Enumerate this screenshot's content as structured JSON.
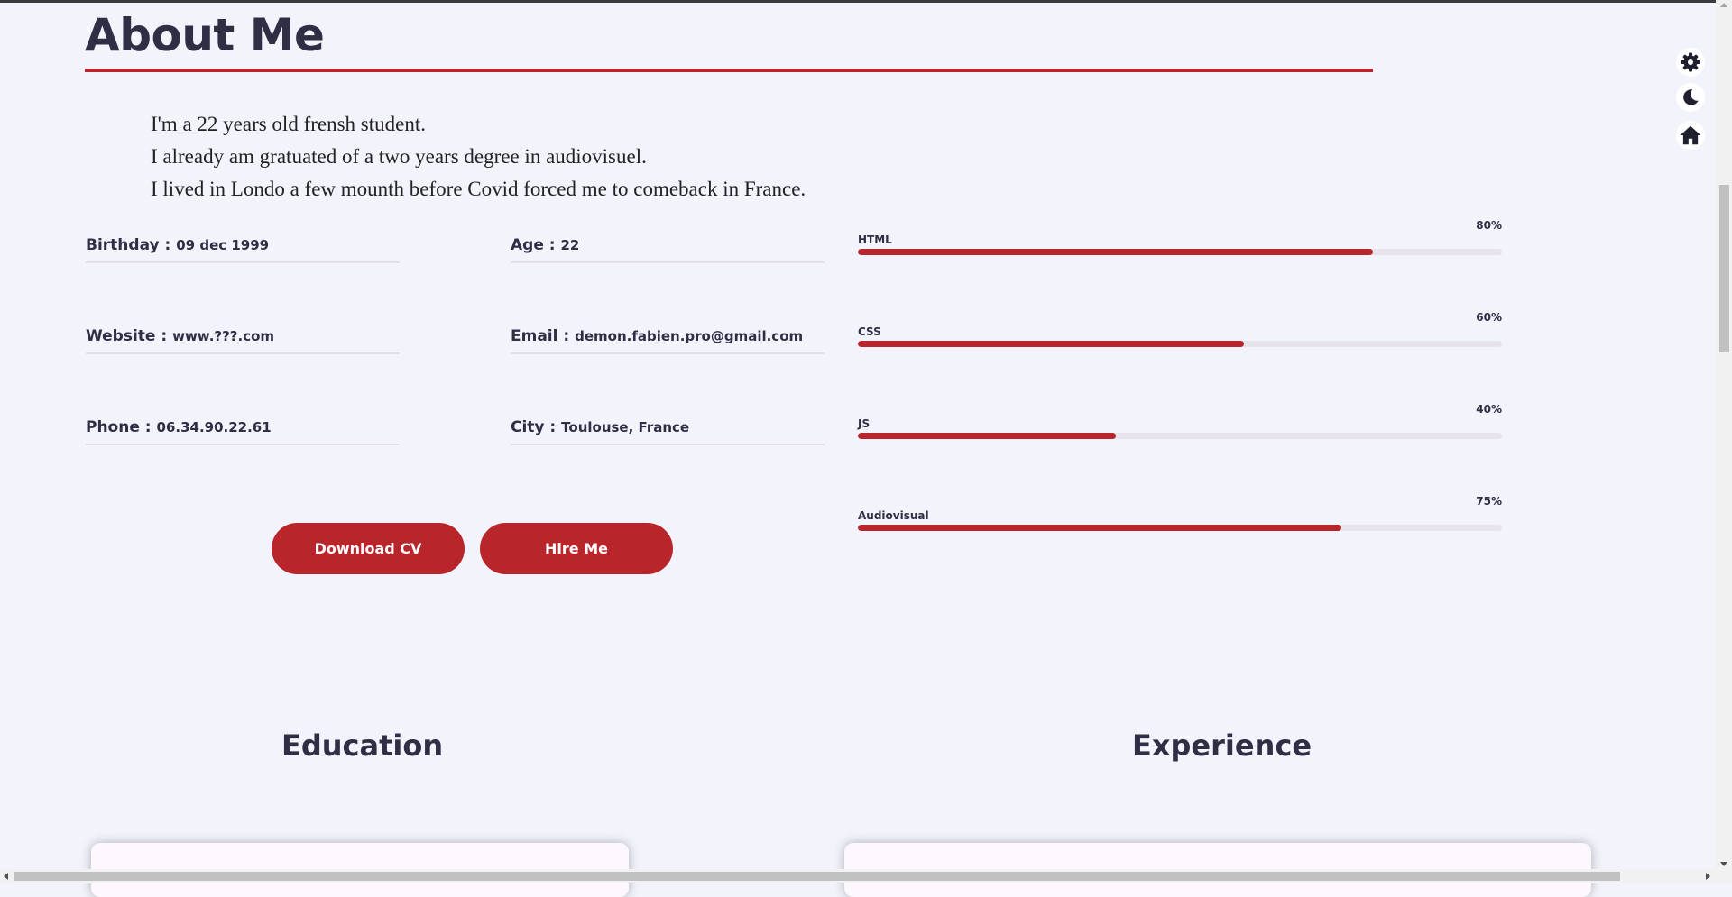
{
  "colors": {
    "accent": "#b8262b",
    "heading": "#2f2e45",
    "background": "#f2f3fb"
  },
  "about": {
    "title": "About Me",
    "bio": [
      "I'm a 22 years old frensh student.",
      "I already am gratuated of a two years degree in audiovisuel.",
      "I lived in Londo a few mounth before Covid forced me to comeback in France."
    ]
  },
  "info": {
    "birthday": {
      "label": "Birthday : ",
      "value": "09 dec 1999"
    },
    "age": {
      "label": "Age : ",
      "value": "22"
    },
    "website": {
      "label": "Website : ",
      "value": "www.???.com"
    },
    "email": {
      "label": "Email : ",
      "value": "demon.fabien.pro@gmail.com"
    },
    "phone": {
      "label": "Phone : ",
      "value": "06.34.90.22.61"
    },
    "city": {
      "label": "City : ",
      "value": "Toulouse, France"
    }
  },
  "buttons": {
    "download_cv": "Download CV",
    "hire_me": "Hire Me"
  },
  "skills": [
    {
      "name": "HTML",
      "percent_label": "80%",
      "level": 0.8
    },
    {
      "name": "CSS",
      "percent_label": "60%",
      "level": 0.6
    },
    {
      "name": "JS",
      "percent_label": "40%",
      "level": 0.4
    },
    {
      "name": "Audiovisual",
      "percent_label": "75%",
      "level": 0.75
    }
  ],
  "sections": {
    "education": "Education",
    "experience": "Experience"
  },
  "side_icons": [
    "gear-icon",
    "moon-icon",
    "home-icon"
  ]
}
